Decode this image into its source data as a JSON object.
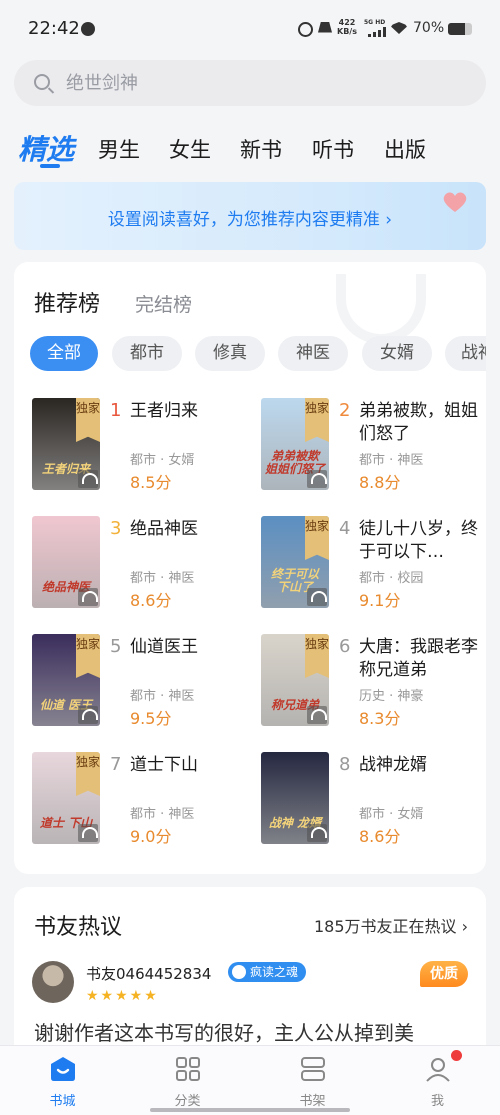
{
  "status_bar": {
    "time": "22:42",
    "net_speed_top": "422",
    "net_speed_unit": "KB/s",
    "signal_type": "5G HD",
    "battery": "70%",
    "battery_level": 0.7
  },
  "search": {
    "placeholder": "绝世剑神"
  },
  "tabs": [
    {
      "label": "精选",
      "active": true
    },
    {
      "label": "男生"
    },
    {
      "label": "女生"
    },
    {
      "label": "新书"
    },
    {
      "label": "听书"
    },
    {
      "label": "出版"
    }
  ],
  "banner": {
    "text": "设置阅读喜好，为您推荐内容更精准 ›"
  },
  "ranking": {
    "tab_active": "推荐榜",
    "tab_other": "完结榜",
    "chips": [
      "全部",
      "都市",
      "修真",
      "神医",
      "女婿",
      "战神"
    ],
    "books": [
      {
        "rank": "1",
        "title": "王者归来",
        "tags": "都市 · 女婿",
        "score": "8.5分",
        "exclusive": "独家",
        "cover_text": "王者归来",
        "audio": true,
        "cover_color": "#2a2622"
      },
      {
        "rank": "2",
        "title": "弟弟被欺，姐姐们怒了",
        "tags": "都市 · 神医",
        "score": "8.8分",
        "exclusive": "独家",
        "cover_text": "弟弟被欺 姐姐们怒了",
        "audio": true,
        "cover_color": "#bcd8ee"
      },
      {
        "rank": "3",
        "title": "绝品神医",
        "tags": "都市 · 神医",
        "score": "8.6分",
        "exclusive": "",
        "cover_text": "绝品神医",
        "audio": true,
        "cover_color": "#f0c7d0"
      },
      {
        "rank": "4",
        "title": "徒儿十八岁，终于可以下…",
        "tags": "都市 · 校园",
        "score": "9.1分",
        "exclusive": "独家",
        "cover_text": "终于可以 下山了",
        "audio": true,
        "cover_color": "#5b8fc2"
      },
      {
        "rank": "5",
        "title": "仙道医王",
        "tags": "都市 · 神医",
        "score": "9.5分",
        "exclusive": "独家",
        "cover_text": "仙道 医王",
        "audio": true,
        "cover_color": "#3a2d5c"
      },
      {
        "rank": "6",
        "title": "大唐：我跟老李称兄道弟",
        "tags": "历史 · 神豪",
        "score": "8.3分",
        "exclusive": "独家",
        "cover_text": "称兄道弟",
        "audio": true,
        "cover_color": "#d9d4cb"
      },
      {
        "rank": "7",
        "title": "道士下山",
        "tags": "都市 · 神医",
        "score": "9.0分",
        "exclusive": "独家",
        "cover_text": "道士 下山",
        "audio": true,
        "cover_color": "#e8d7dc"
      },
      {
        "rank": "8",
        "title": "战神龙婿",
        "tags": "都市 · 女婿",
        "score": "8.6分",
        "exclusive": "",
        "cover_text": "战神 龙婿",
        "audio": true,
        "cover_color": "#242840"
      }
    ]
  },
  "discussion": {
    "title": "书友热议",
    "more": "185万书友正在热议 ›",
    "user_name": "书友0464452834",
    "user_badge": "疯读之魂",
    "stars": "★★★★★",
    "quality_badge": "优质",
    "comment": "谢谢作者这本书写的很好，主人公从掉到美"
  },
  "bottom_nav": [
    {
      "label": "书城",
      "active": true
    },
    {
      "label": "分类"
    },
    {
      "label": "书架"
    },
    {
      "label": "我"
    }
  ],
  "colors": {
    "accent": "#1e7cf0",
    "score": "#e88a2e",
    "exclusive": "#e3bf77"
  }
}
